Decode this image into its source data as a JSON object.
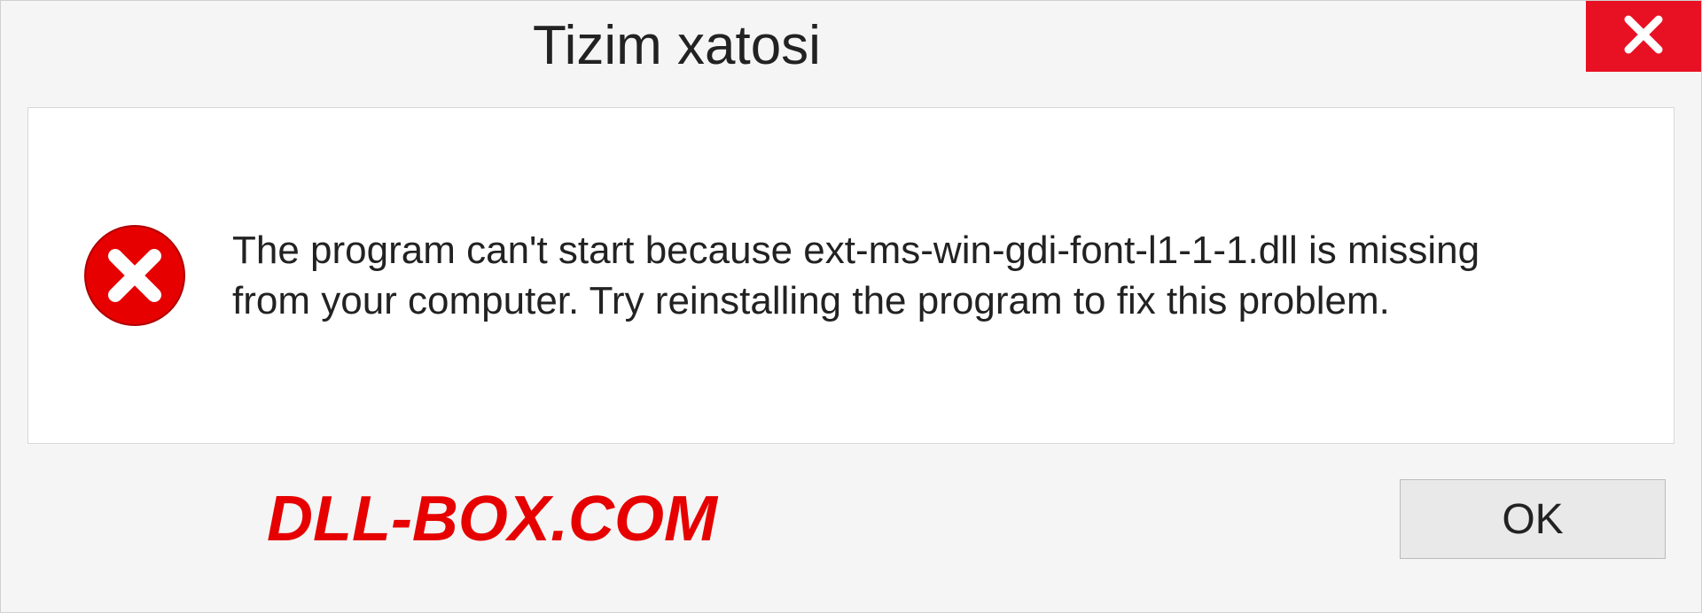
{
  "dialog": {
    "title": "Tizim xatosi",
    "message": "The program can't start because ext-ms-win-gdi-font-l1-1-1.dll is missing from your computer. Try reinstalling the program to fix this problem.",
    "ok_label": "OK"
  },
  "watermark": "DLL-BOX.COM"
}
